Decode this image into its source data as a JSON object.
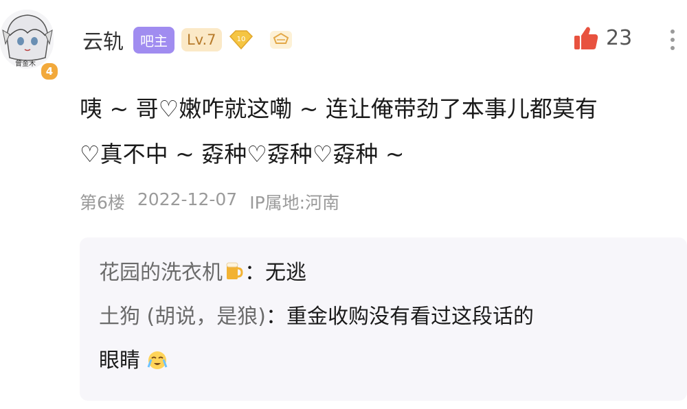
{
  "post": {
    "username": "云轨",
    "tag_admin": "吧主",
    "tag_level": "Lv.7",
    "gem_level": "10",
    "avatar_badge": "4",
    "avatar_caption": "曾金木",
    "like_count": "23",
    "content_lines": [
      "咦 ~ 哥♡嫩咋就这嘞 ~ 连让俺带劲了本事儿都莫有",
      "♡真不中 ~ 孬种♡孬种♡孬种 ~"
    ],
    "floor": "第6楼",
    "date": "2022-12-07",
    "ip_location": "IP属地:河南"
  },
  "replies": [
    {
      "user": "花园的洗衣机",
      "emoji": "beer-icon",
      "separator": "：",
      "text": "无逃"
    },
    {
      "user": "土狗 (胡说，是狼)",
      "separator": "：",
      "text_line1": "重金收购没有看过这段话的",
      "text_line2": "眼睛",
      "emoji": "crying-face-icon"
    }
  ],
  "colors": {
    "admin_tag": "#a08cf0",
    "level_tag_bg": "#fbe9c7",
    "level_tag_text": "#b77a2a",
    "like_red": "#e8523f",
    "reply_bg": "#f7f6fa",
    "meta_text": "#9a9a9a"
  }
}
